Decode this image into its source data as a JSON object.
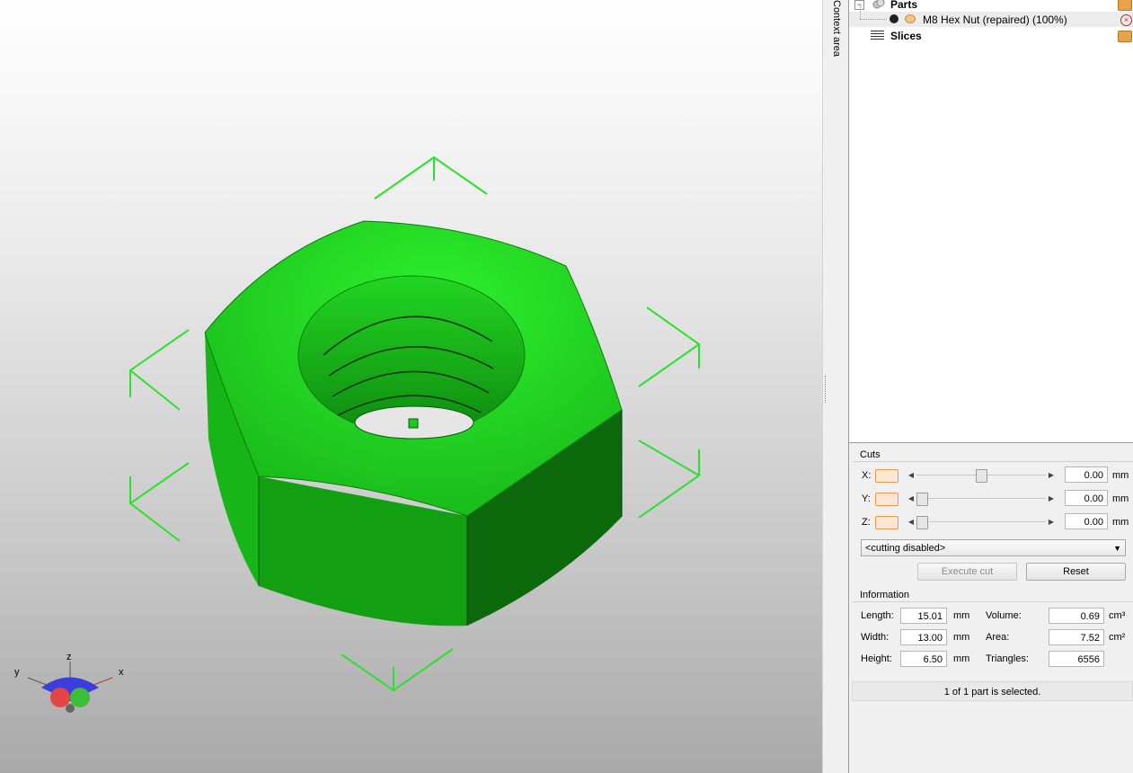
{
  "viewport": {
    "model_color": "#1fce1f",
    "axis_labels": {
      "x": "x",
      "y": "y",
      "z": "z"
    }
  },
  "context_tab": {
    "label": "Context area"
  },
  "tree": {
    "parts_label": "Parts",
    "part_item_label": "M8 Hex Nut (repaired) (100%)",
    "slices_label": "Slices"
  },
  "cuts": {
    "title": "Cuts",
    "rows": [
      {
        "axis": "X:",
        "value": "0.00",
        "unit": "mm",
        "slider_fraction": 0.5
      },
      {
        "axis": "Y:",
        "value": "0.00",
        "unit": "mm",
        "slider_fraction": 0.0
      },
      {
        "axis": "Z:",
        "value": "0.00",
        "unit": "mm",
        "slider_fraction": 0.0
      }
    ],
    "mode_select": "<cutting disabled>",
    "execute_label": "Execute cut",
    "reset_label": "Reset"
  },
  "information": {
    "title": "Information",
    "length_label": "Length:",
    "length_value": "15.01",
    "length_unit": "mm",
    "width_label": "Width:",
    "width_value": "13.00",
    "width_unit": "mm",
    "height_label": "Height:",
    "height_value": "6.50",
    "height_unit": "mm",
    "volume_label": "Volume:",
    "volume_value": "0.69",
    "volume_unit": "cm³",
    "area_label": "Area:",
    "area_value": "7.52",
    "area_unit": "cm²",
    "triangles_label": "Triangles:",
    "triangles_value": "6556"
  },
  "status": {
    "text": "1 of 1 part is selected."
  }
}
